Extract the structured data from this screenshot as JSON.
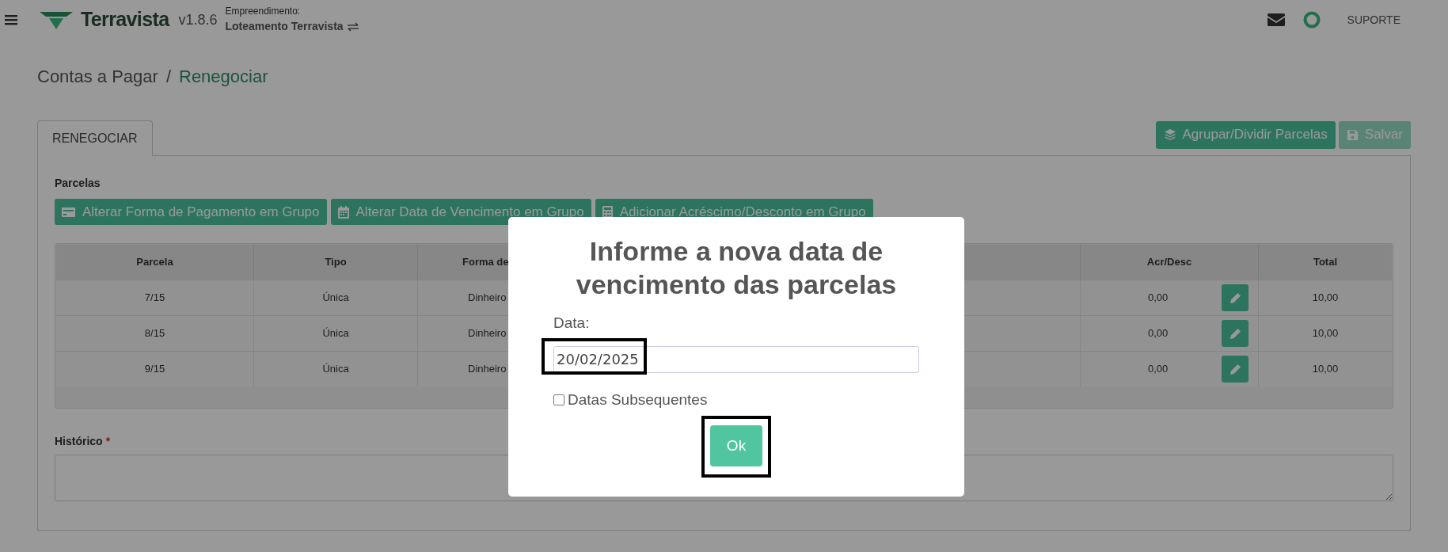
{
  "topbar": {
    "brand": "Terravista",
    "version": "v1.8.6",
    "project_label": "Empreendimento:",
    "project": "Loteamento Terravista",
    "support": "SUPORTE"
  },
  "breadcrumb": {
    "items": [
      "Contas a Pagar",
      "Renegociar"
    ],
    "separator": "/"
  },
  "tabs": [
    {
      "label": "RENEGOCIAR",
      "selected": true
    }
  ],
  "actions": [
    {
      "label": "Agrupar/Dividir Parcelas",
      "disabled": false
    },
    {
      "label": "Salvar",
      "disabled": true
    }
  ],
  "section_title": "Parcelas",
  "group_buttons": [
    {
      "label": "Alterar Forma de Pagamento em Grupo"
    },
    {
      "label": "Alterar Data de Vencimento em Grupo"
    },
    {
      "label": "Adicionar Acréscimo/Desconto em Grupo"
    }
  ],
  "table": {
    "columns": [
      "Parcela",
      "Tipo",
      "Forma de",
      "Acr/Desc",
      "Total"
    ],
    "rows": [
      {
        "parcela": "7/15",
        "tipo": "Única",
        "forma": "Dinheiro",
        "acr_desc": "0,00",
        "total": "10,00"
      },
      {
        "parcela": "8/15",
        "tipo": "Única",
        "forma": "Dinheiro",
        "acr_desc": "0,00",
        "total": "10,00"
      },
      {
        "parcela": "9/15",
        "tipo": "Única",
        "forma": "Dinheiro",
        "acr_desc": "0,00",
        "total": "10,00"
      }
    ]
  },
  "historico": {
    "label": "Histórico",
    "required": true,
    "required_mark": "*"
  },
  "modal": {
    "title": "Informe a nova data de vencimento das parcelas",
    "field_label": "Data:",
    "value": "20/02/2025",
    "field_highlighted": true,
    "checkbox": {
      "label": "Datas Subsequentes",
      "checked": false
    },
    "button": {
      "label": "Ok",
      "highlighted": true
    }
  }
}
